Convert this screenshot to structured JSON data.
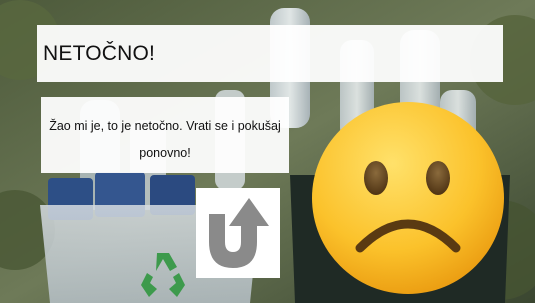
{
  "dialog": {
    "title": "NETOČNO!",
    "message": "Žao mi je, to je netočno. Vrati se i pokušaj ponovno!"
  },
  "icons": {
    "retry": "return-arrow-icon",
    "emoji": "sad-face-icon",
    "recycle": "recycle-icon"
  },
  "colors": {
    "panel_background": "#ffffff",
    "retry_arrow": "#8a8a8a",
    "emoji_face": "#f9b81f",
    "emoji_features": "#5a3a12"
  }
}
